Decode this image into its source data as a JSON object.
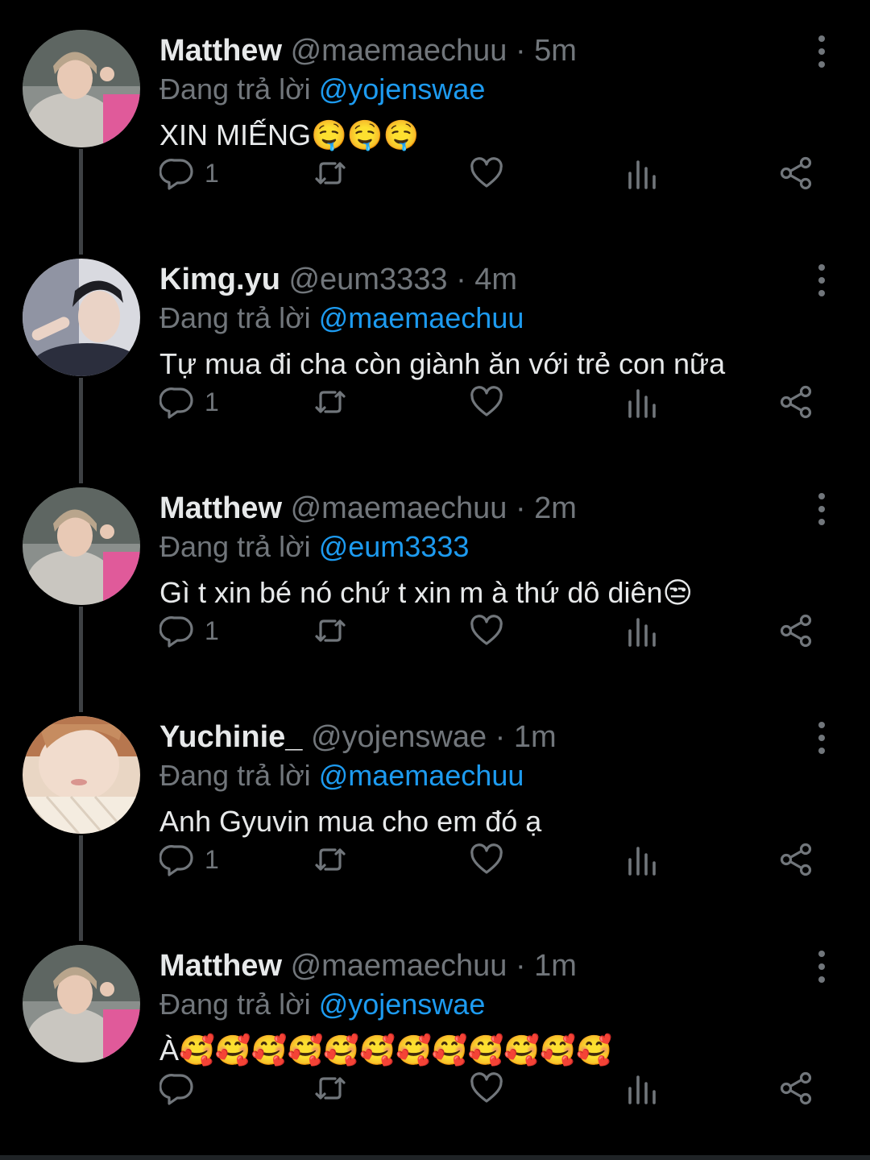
{
  "tweets": [
    {
      "name": "Matthew",
      "handle": "@maemaechuu",
      "separator": "·",
      "time": "5m",
      "reply_prefix": "Đang trả lời",
      "reply_to": "@yojenswae",
      "text": "XIN MIẾNG🤤🤤🤤",
      "reply_count": "1"
    },
    {
      "name": "Kimg.yu",
      "handle": "@eum3333",
      "separator": "·",
      "time": "4m",
      "reply_prefix": "Đang trả lời",
      "reply_to": "@maemaechuu",
      "text": "Tự mua đi cha còn giành ăn với trẻ con nữa",
      "reply_count": "1"
    },
    {
      "name": "Matthew",
      "handle": "@maemaechuu",
      "separator": "·",
      "time": "2m",
      "reply_prefix": "Đang trả lời",
      "reply_to": "@eum3333",
      "text": "Gì t xin bé nó chứ t xin m à thứ dô diên😒",
      "reply_count": "1"
    },
    {
      "name": "Yuchinie_",
      "handle": "@yojenswae",
      "separator": "·",
      "time": "1m",
      "reply_prefix": "Đang trả lời",
      "reply_to": "@maemaechuu",
      "text": "Anh Gyuvin mua cho em đó ạ",
      "reply_count": "1"
    },
    {
      "name": "Matthew",
      "handle": "@maemaechuu",
      "separator": "·",
      "time": "1m",
      "reply_prefix": "Đang trả lời",
      "reply_to": "@yojenswae",
      "text": "À🥰🥰🥰🥰🥰🥰🥰🥰🥰🥰🥰🥰",
      "reply_count": ""
    }
  ],
  "icons": {
    "reply": "reply-icon",
    "retweet": "retweet-icon",
    "like": "heart-icon",
    "views": "views-icon",
    "share": "share-icon",
    "more": "more-icon"
  },
  "colors": {
    "background": "#000000",
    "text": "#e7e9ea",
    "muted": "#71767b",
    "mention": "#1d9bf0",
    "thread_line": "#3e4144"
  }
}
